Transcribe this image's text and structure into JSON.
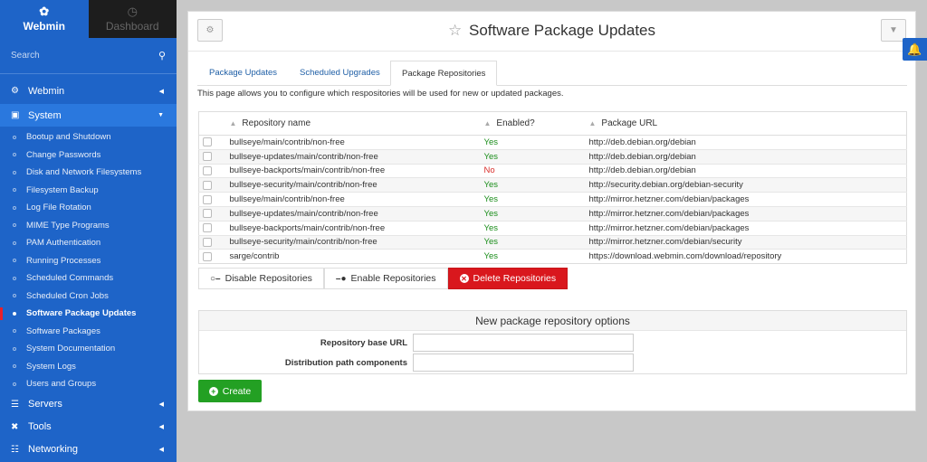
{
  "sidebar": {
    "webmin_tab": "Webmin",
    "dashboard_tab": "Dashboard",
    "search_placeholder": "Search",
    "sections": [
      {
        "label": "Webmin",
        "icon": "gear-icon"
      },
      {
        "label": "System",
        "icon": "laptop-icon"
      },
      {
        "label": "Servers",
        "icon": "server-icon"
      },
      {
        "label": "Tools",
        "icon": "tools-icon"
      },
      {
        "label": "Networking",
        "icon": "network-icon"
      }
    ],
    "system_items": [
      "Bootup and Shutdown",
      "Change Passwords",
      "Disk and Network Filesystems",
      "Filesystem Backup",
      "Log File Rotation",
      "MIME Type Programs",
      "PAM Authentication",
      "Running Processes",
      "Scheduled Commands",
      "Scheduled Cron Jobs",
      "Software Package Updates",
      "Software Packages",
      "System Documentation",
      "System Logs",
      "Users and Groups"
    ],
    "active_item": "Software Package Updates",
    "accent_color": "#1e64c8"
  },
  "header": {
    "title": "Software Package Updates"
  },
  "tabs": [
    "Package Updates",
    "Scheduled Upgrades",
    "Package Repositories"
  ],
  "active_tab": "Package Repositories",
  "description": "This page allows you to configure which respositories will be used for new or updated packages.",
  "table": {
    "headers": [
      "Repository name",
      "Enabled?",
      "Package URL"
    ],
    "rows": [
      {
        "name": "bullseye/main/contrib/non-free",
        "enabled": "Yes",
        "url": "http://deb.debian.org/debian"
      },
      {
        "name": "bullseye-updates/main/contrib/non-free",
        "enabled": "Yes",
        "url": "http://deb.debian.org/debian"
      },
      {
        "name": "bullseye-backports/main/contrib/non-free",
        "enabled": "No",
        "url": "http://deb.debian.org/debian"
      },
      {
        "name": "bullseye-security/main/contrib/non-free",
        "enabled": "Yes",
        "url": "http://security.debian.org/debian-security"
      },
      {
        "name": "bullseye/main/contrib/non-free",
        "enabled": "Yes",
        "url": "http://mirror.hetzner.com/debian/packages"
      },
      {
        "name": "bullseye-updates/main/contrib/non-free",
        "enabled": "Yes",
        "url": "http://mirror.hetzner.com/debian/packages"
      },
      {
        "name": "bullseye-backports/main/contrib/non-free",
        "enabled": "Yes",
        "url": "http://mirror.hetzner.com/debian/packages"
      },
      {
        "name": "bullseye-security/main/contrib/non-free",
        "enabled": "Yes",
        "url": "http://mirror.hetzner.com/debian/security"
      },
      {
        "name": "sarge/contrib",
        "enabled": "Yes",
        "url": "https://download.webmin.com/download/repository"
      }
    ]
  },
  "actions": {
    "disable": "Disable Repositories",
    "enable": "Enable Repositories",
    "delete": "Delete Repositories"
  },
  "options": {
    "title": "New package repository options",
    "base_url_label": "Repository base URL",
    "base_url_value": "",
    "dist_label": "Distribution path components",
    "dist_value": ""
  },
  "create_label": "Create"
}
